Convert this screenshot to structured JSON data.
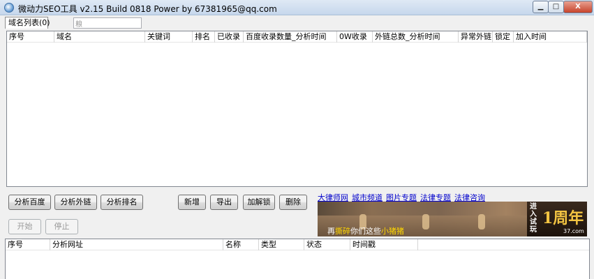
{
  "window": {
    "title": "微动力SEO工具 v2.15 Build 0818 Power by 67381965@qq.com",
    "min_glyph": "▁",
    "max_glyph": "□",
    "close_glyph": "X"
  },
  "tab": {
    "label": "域名列表(0)"
  },
  "search": {
    "value": "粮"
  },
  "domain_table": {
    "columns": [
      "序号",
      "域名",
      "关键词",
      "排名",
      "已收录",
      "百度收录数量_分析时间",
      "0W收录",
      "外链总数_分析时间",
      "异常外链",
      "锁定",
      "加入时间"
    ]
  },
  "buttons": {
    "analyze_baidu": "分析百度",
    "analyze_backlinks": "分析外链",
    "analyze_ranking": "分析排名",
    "add_new": "新增",
    "export": "导出",
    "lock_unlock": "加解锁",
    "delete": "删除",
    "start": "开始",
    "stop": "停止"
  },
  "ad": {
    "links": [
      "大律师网",
      "城市频道",
      "图片专题",
      "法律专题",
      "法律咨询"
    ],
    "caption_prefix": "再",
    "caption_hl1": "撕碎",
    "caption_mid": "你们这些",
    "caption_hl2": "小猪猪",
    "logo_side": "进入试玩",
    "logo_main": "1周年",
    "logo_sub": "37.com"
  },
  "url_table": {
    "columns": [
      "序号",
      "分析网址",
      "名称",
      "类型",
      "状态",
      "时间戳"
    ]
  }
}
